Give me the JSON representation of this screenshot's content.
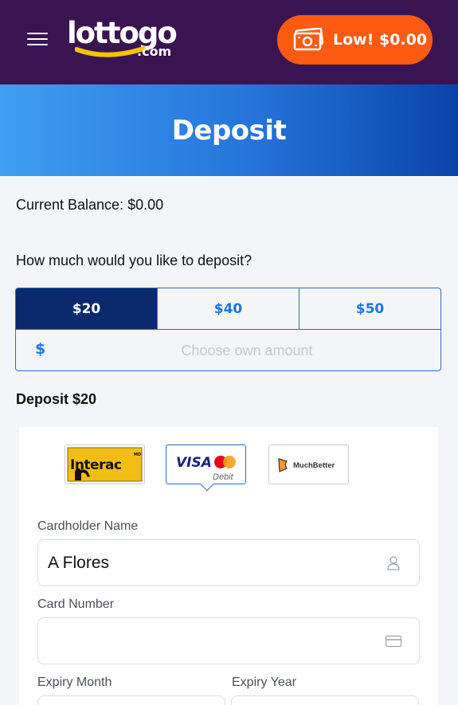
{
  "header": {
    "logo_main": "lottogo",
    "logo_suffix": ".com",
    "balance_button_label": "Low! $0.00",
    "colors": {
      "background": "#3a1450",
      "balance_button": "#ff5a12",
      "logo_swoosh": "#f4c400"
    }
  },
  "hero": {
    "title": "Deposit"
  },
  "balance": {
    "text": "Current Balance: $0.00"
  },
  "deposit": {
    "question": "How much would you like to deposit?",
    "amount_options": [
      {
        "label": "$20",
        "selected": true
      },
      {
        "label": "$40",
        "selected": false
      },
      {
        "label": "$50",
        "selected": false
      }
    ],
    "own_amount": {
      "currency_symbol": "$",
      "value": "",
      "placeholder": "Choose own amount"
    },
    "summary": "Deposit $20"
  },
  "payment_methods": [
    {
      "name": "Interac",
      "label": "Interac",
      "badge": "MD",
      "selected": false
    },
    {
      "name": "Visa Mastercard Debit",
      "label_visa": "VISA",
      "label_debit": "Debit",
      "selected": true
    },
    {
      "name": "MuchBetter",
      "label": "MuchBetter",
      "selected": false
    }
  ],
  "form": {
    "cardholder_name": {
      "label": "Cardholder Name",
      "value": "A Flores",
      "icon": "user-icon"
    },
    "card_number": {
      "label": "Card Number",
      "value": "",
      "icon": "credit-card-icon"
    },
    "expiry_month": {
      "label": "Expiry Month"
    },
    "expiry_year": {
      "label": "Expiry Year"
    }
  }
}
